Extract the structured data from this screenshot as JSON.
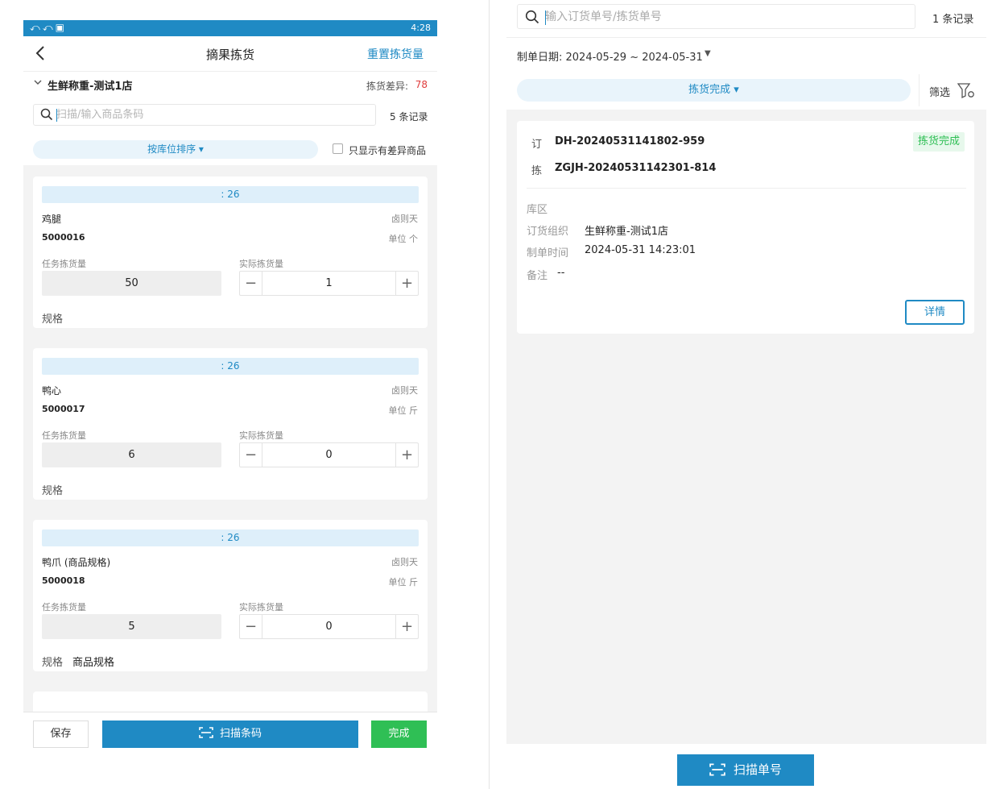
{
  "left": {
    "statusbar": {
      "icons": "⤺⤺▣",
      "time": "4:28"
    },
    "navbar": {
      "title": "摘果拣货",
      "reset_label": "重置拣货量"
    },
    "store": {
      "name": "生鲜称重-测试1店",
      "diff_label": "拣货差异:",
      "diff_value": "78"
    },
    "search": {
      "placeholder": "扫描/输入商品条码",
      "record_count": "5 条记录"
    },
    "sort_label": "按库位排序 ▾",
    "only_diff_label": "只显示有差异商品",
    "labels": {
      "task_qty": "任务拣货量",
      "actual_qty": "实际拣货量",
      "spec": "规格"
    },
    "items": [
      {
        "head": ": 26",
        "name": "鸡腿",
        "tag": "卤则天",
        "code": "5000016",
        "unit": "单位 个",
        "task_qty": "50",
        "actual_qty": "1",
        "spec": ""
      },
      {
        "head": ": 26",
        "name": "鸭心",
        "tag": "卤则天",
        "code": "5000017",
        "unit": "单位 斤",
        "task_qty": "6",
        "actual_qty": "0",
        "spec": ""
      },
      {
        "head": ": 26",
        "name": "鸭爪 (商品规格)",
        "tag": "卤则天",
        "code": "5000018",
        "unit": "单位 斤",
        "task_qty": "5",
        "actual_qty": "0",
        "spec": "商品规格"
      }
    ],
    "bottom": {
      "save": "保存",
      "scan": "扫描条码",
      "done": "完成"
    }
  },
  "right": {
    "search": {
      "placeholder": "输入订货单号/拣货单号",
      "record_count": "1 条记录"
    },
    "date_filter": "制单日期: 2024-05-29 ~ 2024-05-31",
    "status_label": "拣货完成 ▾",
    "filter_label": "筛选",
    "card": {
      "order_tag": "订",
      "order_no": "DH-20240531141802-959",
      "pick_tag": "拣",
      "pick_no": "ZGJH-20240531142301-814",
      "badge": "拣货完成",
      "fields": [
        {
          "label": "库区",
          "value": ""
        },
        {
          "label": "订货组织",
          "value": "生鲜称重-测试1店"
        },
        {
          "label": "制单时间",
          "value": "2024-05-31 14:23:01"
        },
        {
          "label": "备注",
          "value": "--"
        }
      ],
      "detail_label": "详情"
    },
    "scan_button": "扫描单号"
  },
  "colors": {
    "accent": "#1f8ac4",
    "success": "#2fbf55",
    "danger": "#e03c3c"
  },
  "icons": [
    "back-icon",
    "search-icon",
    "scan-icon",
    "filter-icon",
    "chevron-down-icon",
    "minus-icon",
    "plus-icon"
  ]
}
